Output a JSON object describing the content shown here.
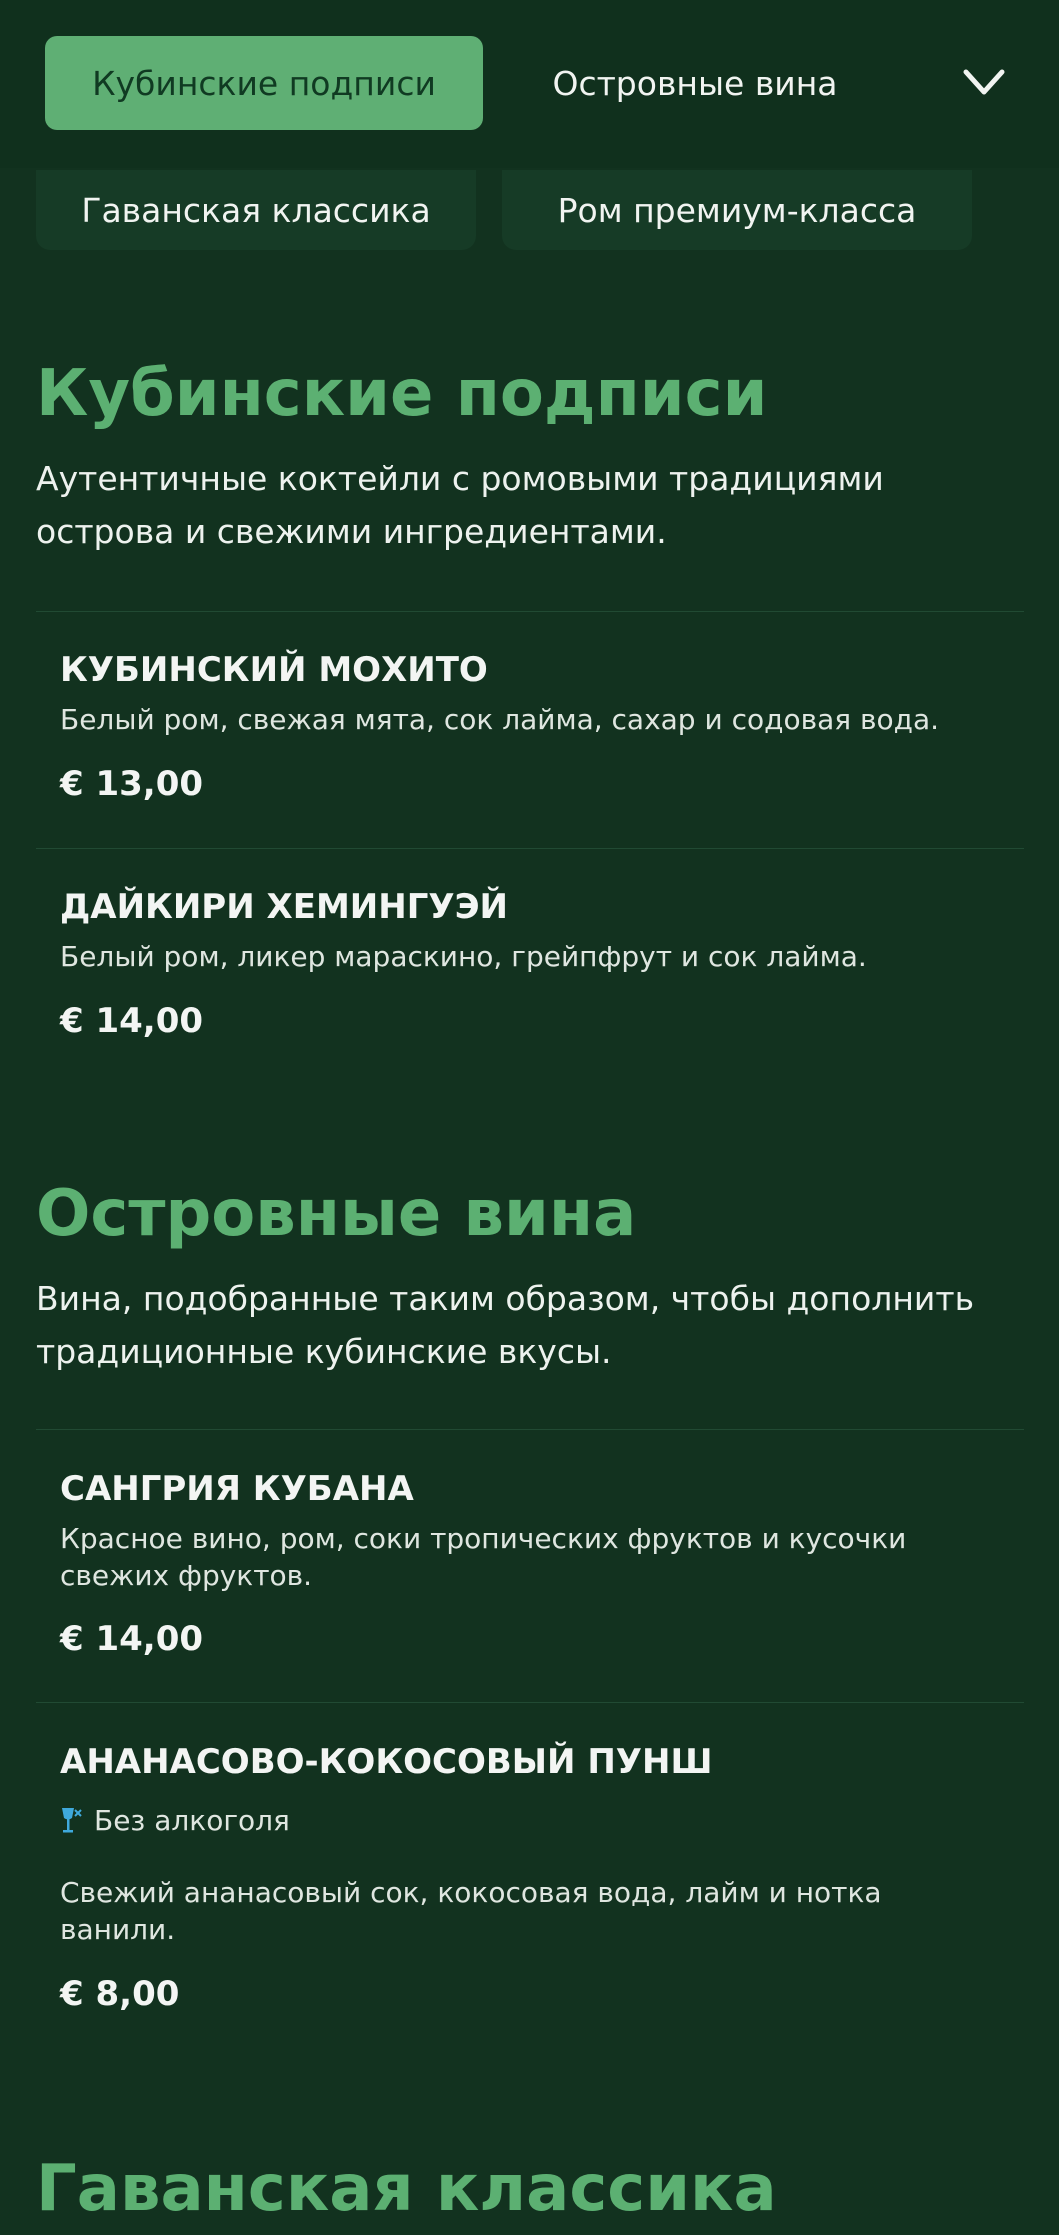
{
  "nav": {
    "tabs": [
      {
        "label": "Кубинские подписи",
        "active": true
      },
      {
        "label": "Островные вина",
        "active": false
      },
      {
        "label": "Гаванская классика",
        "active": false
      },
      {
        "label": "Ром премиум-класса",
        "active": false
      }
    ],
    "expand_icon": "chevron-down-icon"
  },
  "sections": [
    {
      "title": "Кубинские подписи",
      "description": "Аутентичные коктейли с ромовыми традициями острова и свежими ингредиентами.",
      "items": [
        {
          "name": "КУБИНСКИЙ МОХИТО",
          "description": "Белый ром, свежая мята, сок лайма, сахар и содовая вода.",
          "price": "€ 13,00"
        },
        {
          "name": "ДАЙКИРИ ХЕМИНГУЭЙ",
          "description": "Белый ром, ликер мараскино, грейпфрут и сок лайма.",
          "price": "€ 14,00"
        }
      ]
    },
    {
      "title": "Островные вина",
      "description": "Вина, подобранные таким образом, чтобы дополнить традиционные кубинские вкусы.",
      "items": [
        {
          "name": "САНГРИЯ КУБАНА",
          "description": "Красное вино, ром, соки тропических фруктов и кусочки свежих фруктов.",
          "price": "€ 14,00"
        },
        {
          "name": "АНАНАСОВО-КОКОСОВЫЙ ПУНШ",
          "badge": "Без алкоголя",
          "badge_icon": "no-alcohol-icon",
          "description": "Свежий ананасовый сок, кокосовая вода, лайм и нотка ванили.",
          "price": "€ 8,00"
        }
      ]
    },
    {
      "title": "Гаванская классика"
    }
  ],
  "colors": {
    "background": "#12321f",
    "accent": "#5cb072",
    "active_tab": "#5faf74",
    "badge_icon": "#3fa9dc"
  }
}
